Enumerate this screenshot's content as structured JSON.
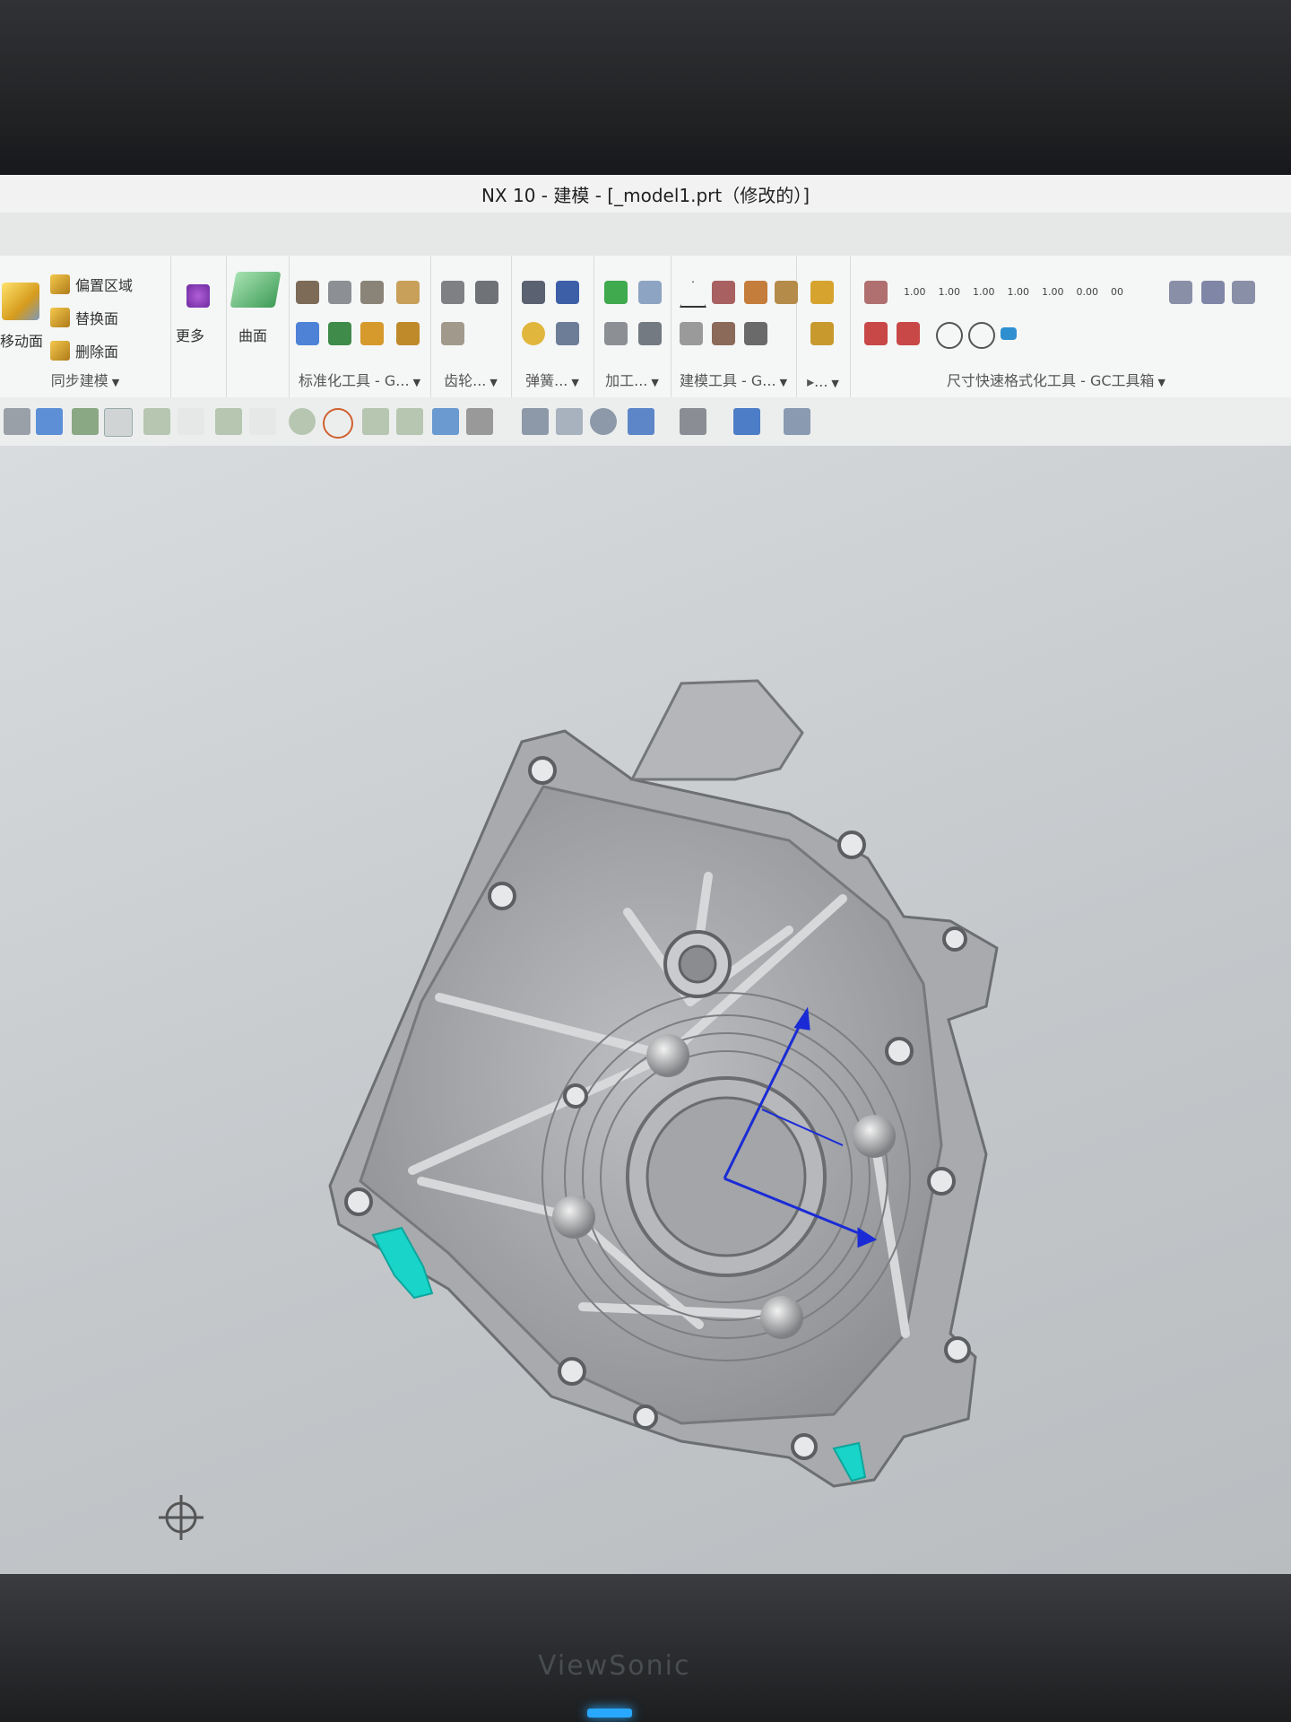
{
  "window": {
    "title": "NX 10 - 建模 - [_model1.prt（修改的）]"
  },
  "ribbon": {
    "sync_group": {
      "move_face": "移动面",
      "offset_region": "偏置区域",
      "replace_face": "替换面",
      "delete_face": "删除面",
      "label": "同步建模"
    },
    "more_label": "更多",
    "surface_label": "曲面",
    "groups": [
      {
        "label": "标准化工具 - G..."
      },
      {
        "label": "齿轮..."
      },
      {
        "label": "弹簧..."
      },
      {
        "label": "加工..."
      },
      {
        "label": "建模工具 - G..."
      },
      {
        "label": "尺寸快速格式化工具 - GC工具箱"
      }
    ],
    "dim_samples": [
      "1.00",
      "1.00",
      "1.00",
      "1.00",
      "1.00",
      "0.00",
      "00"
    ]
  },
  "colors": {
    "highlight_face": "#19d4c8",
    "csys": "#1a2bd6",
    "model_gray": "#a8aaad"
  },
  "monitor": {
    "brand": "ViewSonic"
  }
}
